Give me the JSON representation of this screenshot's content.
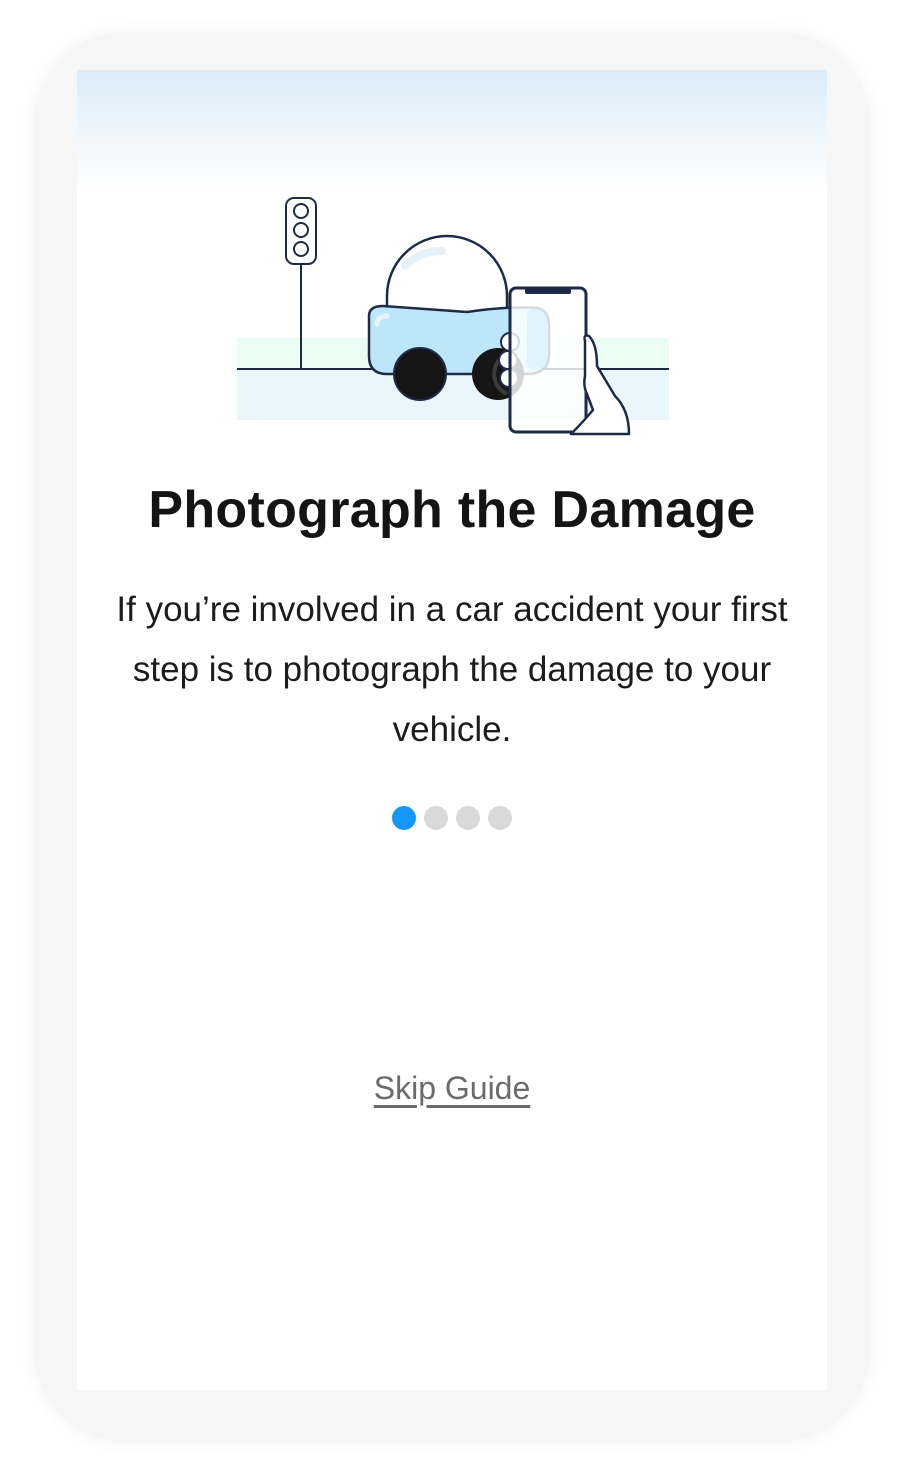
{
  "onboarding": {
    "title": "Photograph the Damage",
    "description": "If you’re involved in a car accident your first step is to photograph the damage to your vehicle.",
    "skip_label": "Skip Guide",
    "pagination": {
      "current": 1,
      "total": 4
    }
  },
  "illustration": {
    "icons": [
      "traffic-light-icon",
      "car-icon",
      "smartphone-icon",
      "hand-icon"
    ]
  },
  "colors": {
    "accent": "#1597f7",
    "inactive_dot": "#d9d9d9",
    "title": "#141414",
    "link": "#6b6b6b",
    "outline": "#1e2a47",
    "car_glass": "#bde6fb"
  }
}
